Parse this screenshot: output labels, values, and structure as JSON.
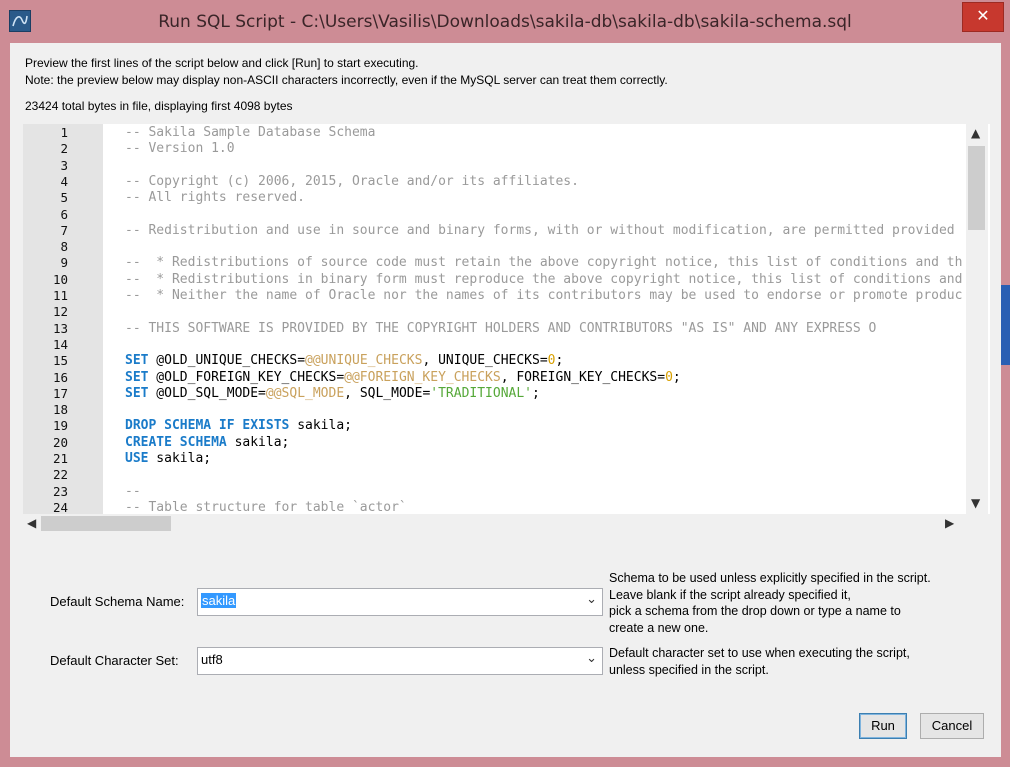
{
  "window": {
    "title": "Run SQL Script - C:\\Users\\Vasilis\\Downloads\\sakila-db\\sakila-db\\sakila-schema.sql",
    "close_label": "✕"
  },
  "info": {
    "line1": "Preview the first lines of the script below and click [Run] to start executing.",
    "line2": "Note: the preview below may display non-ASCII characters incorrectly, even if the MySQL server can treat them correctly.",
    "bytes": "23424 total bytes in file, displaying first 4098 bytes"
  },
  "editor": {
    "lines": [
      {
        "n": "1",
        "parts": [
          {
            "c": "cm",
            "t": "-- Sakila Sample Database Schema"
          }
        ]
      },
      {
        "n": "2",
        "parts": [
          {
            "c": "cm",
            "t": "-- Version 1.0"
          }
        ]
      },
      {
        "n": "3",
        "parts": []
      },
      {
        "n": "4",
        "parts": [
          {
            "c": "cm",
            "t": "-- Copyright (c) 2006, 2015, Oracle and/or its affiliates."
          }
        ]
      },
      {
        "n": "5",
        "parts": [
          {
            "c": "cm",
            "t": "-- All rights reserved."
          }
        ]
      },
      {
        "n": "6",
        "parts": []
      },
      {
        "n": "7",
        "parts": [
          {
            "c": "cm",
            "t": "-- Redistribution and use in source and binary forms, with or without modification, are permitted provided that the fol"
          }
        ]
      },
      {
        "n": "8",
        "parts": []
      },
      {
        "n": "9",
        "parts": [
          {
            "c": "cm",
            "t": "--  * Redistributions of source code must retain the above copyright notice, this list of conditions and the following dis"
          }
        ]
      },
      {
        "n": "10",
        "parts": [
          {
            "c": "cm",
            "t": "--  * Redistributions in binary form must reproduce the above copyright notice, this list of conditions and the following"
          }
        ]
      },
      {
        "n": "11",
        "parts": [
          {
            "c": "cm",
            "t": "--  * Neither the name of Oracle nor the names of its contributors may be used to endorse or promote products deriv"
          }
        ]
      },
      {
        "n": "12",
        "parts": []
      },
      {
        "n": "13",
        "parts": [
          {
            "c": "cm",
            "t": "-- THIS SOFTWARE IS PROVIDED BY THE COPYRIGHT HOLDERS AND CONTRIBUTORS \"AS IS\" AND ANY EXPRESS O"
          }
        ]
      },
      {
        "n": "14",
        "parts": []
      },
      {
        "n": "15",
        "parts": [
          {
            "c": "kw",
            "t": "SET"
          },
          {
            "c": "tx",
            "t": " @OLD_UNIQUE_CHECKS="
          },
          {
            "c": "var",
            "t": "@@UNIQUE_CHECKS"
          },
          {
            "c": "tx",
            "t": ", UNIQUE_CHECKS="
          },
          {
            "c": "num",
            "t": "0"
          },
          {
            "c": "tx",
            "t": ";"
          }
        ]
      },
      {
        "n": "16",
        "parts": [
          {
            "c": "kw",
            "t": "SET"
          },
          {
            "c": "tx",
            "t": " @OLD_FOREIGN_KEY_CHECKS="
          },
          {
            "c": "var",
            "t": "@@FOREIGN_KEY_CHECKS"
          },
          {
            "c": "tx",
            "t": ", FOREIGN_KEY_CHECKS="
          },
          {
            "c": "num",
            "t": "0"
          },
          {
            "c": "tx",
            "t": ";"
          }
        ]
      },
      {
        "n": "17",
        "parts": [
          {
            "c": "kw",
            "t": "SET"
          },
          {
            "c": "tx",
            "t": " @OLD_SQL_MODE="
          },
          {
            "c": "var",
            "t": "@@SQL_MODE"
          },
          {
            "c": "tx",
            "t": ", SQL_MODE="
          },
          {
            "c": "str",
            "t": "'TRADITIONAL'"
          },
          {
            "c": "tx",
            "t": ";"
          }
        ]
      },
      {
        "n": "18",
        "parts": []
      },
      {
        "n": "19",
        "parts": [
          {
            "c": "kw",
            "t": "DROP SCHEMA IF EXISTS"
          },
          {
            "c": "tx",
            "t": " sakila;"
          }
        ]
      },
      {
        "n": "20",
        "parts": [
          {
            "c": "kw",
            "t": "CREATE SCHEMA"
          },
          {
            "c": "tx",
            "t": " sakila;"
          }
        ]
      },
      {
        "n": "21",
        "parts": [
          {
            "c": "kw",
            "t": "USE"
          },
          {
            "c": "tx",
            "t": " sakila;"
          }
        ]
      },
      {
        "n": "22",
        "parts": []
      },
      {
        "n": "23",
        "parts": [
          {
            "c": "cm",
            "t": "--"
          }
        ]
      },
      {
        "n": "24",
        "parts": [
          {
            "c": "cm",
            "t": "-- Table structure for table `actor`"
          }
        ]
      }
    ]
  },
  "scrollbar": {
    "up_icon": "chevron-up-icon",
    "down_icon": "chevron-down-icon",
    "left_icon": "chevron-left-icon",
    "right_icon": "chevron-right-icon"
  },
  "form": {
    "schema_label": "Default Schema Name:",
    "schema_value": "sakila",
    "schema_hint": [
      "Schema to be used unless explicitly specified in the script.",
      "Leave blank if the script already specified it,",
      "pick a schema from the drop down or type a name to",
      "create a new one."
    ],
    "charset_label": "Default Character Set:",
    "charset_value": "utf8",
    "charset_hint": [
      "Default character set to use when executing the script,",
      "unless specified in the script."
    ]
  },
  "buttons": {
    "run": "Run",
    "cancel": "Cancel"
  },
  "colors": {
    "frame": "#cd8c95",
    "close": "#c7382e",
    "keyword": "#1a7bc9",
    "comment": "#9a9a9a",
    "variable": "#c9a15c",
    "string": "#55a838"
  }
}
